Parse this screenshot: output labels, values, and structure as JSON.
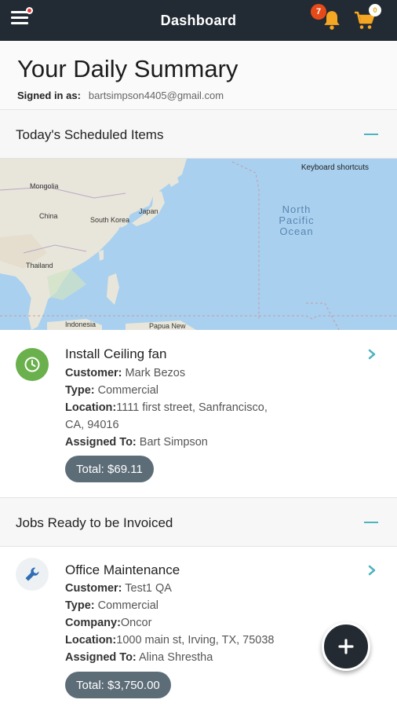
{
  "topbar": {
    "title": "Dashboard",
    "notification_count": "7",
    "cart_count": "0"
  },
  "summary": {
    "heading": "Your Daily Summary",
    "signed_in_label": "Signed in as:",
    "email": "bartsimpson4405@gmail.com"
  },
  "scheduled": {
    "heading": "Today's Scheduled Items",
    "map": {
      "keyboard_shortcuts": "Keyboard shortcuts",
      "ocean": "North Pacific Ocean",
      "labels": [
        "Mongolia",
        "China",
        "South Korea",
        "Japan",
        "Thailand",
        "Indonesia",
        "Papua New"
      ]
    },
    "item": {
      "title": "Install Ceiling fan",
      "customer_label": "Customer:",
      "customer": "Mark Bezos",
      "type_label": "Type:",
      "type": "Commercial",
      "location_label": "Location:",
      "location_line1": "1111 first street, Sanfrancisco,",
      "location_line2": "CA, 94016",
      "assigned_label": "Assigned To:",
      "assigned": "Bart Simpson",
      "total": "Total: $69.11",
      "icon": "clock-icon",
      "icon_color": "#6ab04c"
    }
  },
  "invoice": {
    "heading": "Jobs Ready to be Invoiced",
    "item": {
      "title": "Office Maintenance",
      "customer_label": "Customer:",
      "customer": "Test1 QA",
      "type_label": "Type:",
      "type": "Commercial",
      "company_label": "Company:",
      "company": "Oncor",
      "location_label": "Location:",
      "location": "1000 main st, Irving, TX, 75038",
      "assigned_label": "Assigned To:",
      "assigned": "Alina Shrestha",
      "total": "Total: $3,750.00",
      "icon": "wrench-icon",
      "icon_color": "#2f6eb5"
    }
  },
  "colors": {
    "topbar": "#222a33",
    "accent": "#4fb3bf",
    "pill": "#5d6d78",
    "bell": "#f5a623"
  }
}
